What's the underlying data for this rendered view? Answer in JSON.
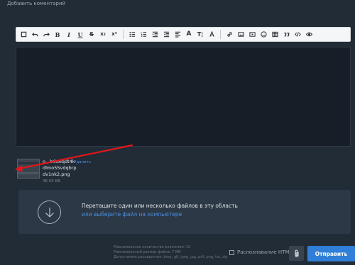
{
  "comment": {
    "heading": "Добавить коментарий"
  },
  "toolbar": {
    "groups": [
      [
        "square-icon",
        "undo-icon",
        "redo-icon",
        "bold-icon",
        "italic-icon",
        "underline-icon",
        "strikethrough-icon",
        "subscript-icon",
        "superscript-icon"
      ],
      [
        "bullet-list-icon",
        "numbered-list-icon",
        "indent-icon",
        "outdent-icon",
        "align-icon",
        "font-size-icon",
        "text-style-icon",
        "font-color-icon"
      ],
      [
        "link-icon",
        "image-icon",
        "video-icon",
        "emoji-icon",
        "table-icon",
        "quote-icon",
        "code-icon",
        "preview-icon"
      ]
    ],
    "glyphs": {
      "bold": "B",
      "italic": "I",
      "underline": "U",
      "strike": "S",
      "sub": "x₂",
      "sup": "x²",
      "fontsize": "A",
      "textstyle": "T¦",
      "fontcolor": "A"
    }
  },
  "attachment": {
    "file_name": "ozlmvclulqyhvcslmc6ozlduqdt4kdlmo55vdqbrpdv1nk2.png",
    "file_name_lines": [
      "o…b6ueqdt4k",
      "dlmo55vdqbrp",
      "dv1nk2.png"
    ],
    "delete_label": "Удалить",
    "size": "46.05 KB"
  },
  "dropzone": {
    "text": "Перетащите один или несколько файлов в эту область",
    "link": "или выберите файл на компьютере"
  },
  "limits": {
    "max_count": "Максимальное количество вложений: 10",
    "max_size": "Максимальный размер файла: 7 MB",
    "extensions": "Допустимые расширения: bmp, gif, jpeg, jpg, pdf, png, txt, zip"
  },
  "footer": {
    "ocr_label": "Распознавание HTML",
    "send_label": "Отправить"
  },
  "colors": {
    "accent": "#2f7fd8",
    "arrow": "#e0161d",
    "background": "#222c37"
  }
}
